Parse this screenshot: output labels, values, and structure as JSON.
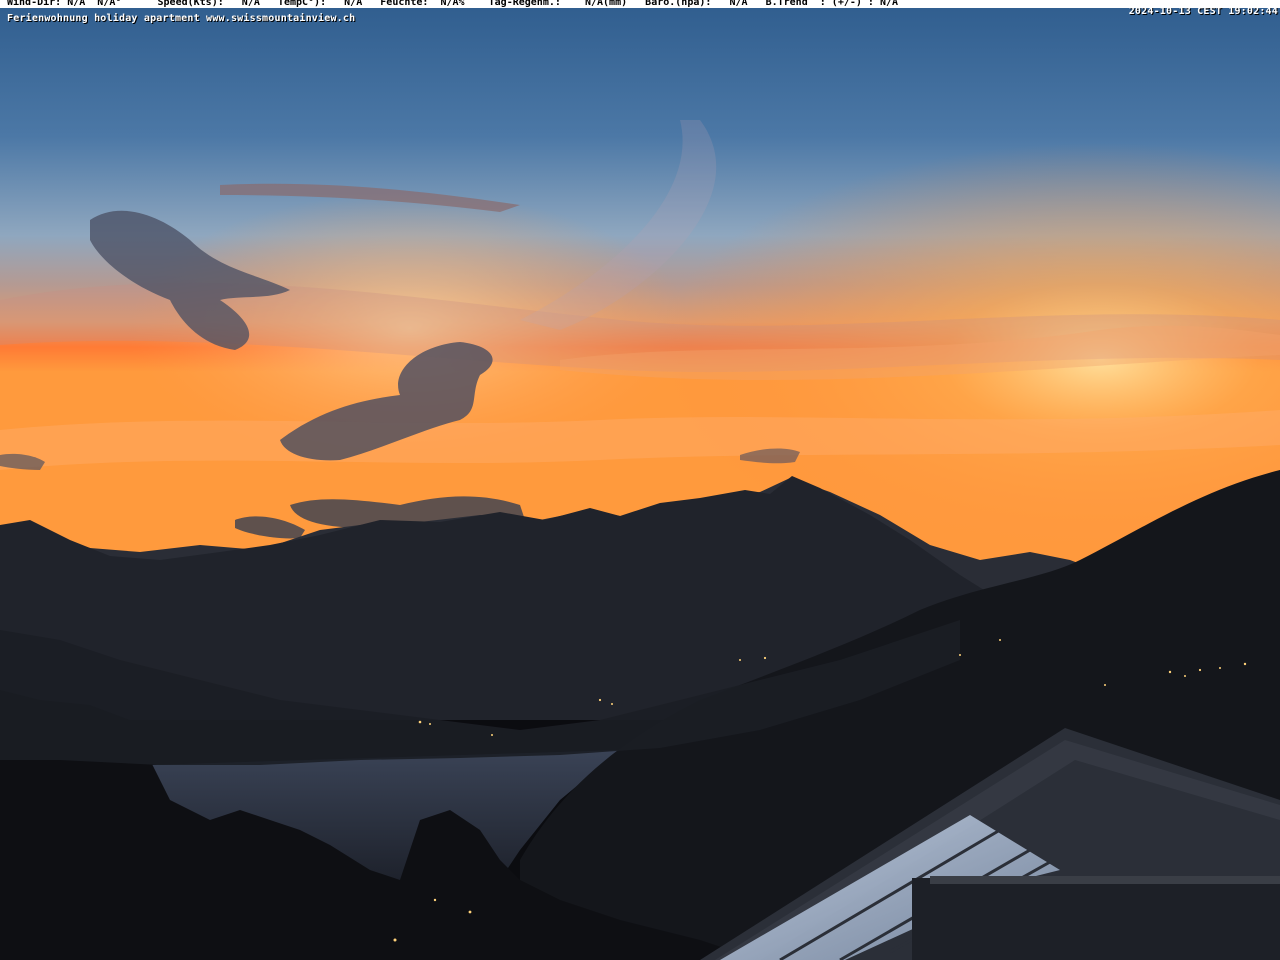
{
  "overlay": {
    "weather_line": "Wind-Dir: N/A  N/A°      Speed(Kts):   N/A   TempC°):   N/A   Feuchte:  N/A%    Tag-Regenm.:    N/A(mm)   Baro.(hpa):   N/A   B.Trend  : (+/-) : N/A",
    "site_caption": "Ferienwohnung holiday apartment www.swissmountainview.ch",
    "timestamp": "2024-10-13 CEST 19:02:44"
  },
  "scene": {
    "subject": "sunset over mountains and lake",
    "colors": {
      "sky_top": "#3f6e9e",
      "sky_mid": "#7fa6c8",
      "sky_glow": "#f4a55a",
      "horizon": "#ff7a2c",
      "mountain": "#22252c",
      "lake": "#323a4a",
      "foreground": "#0c0d10"
    }
  }
}
